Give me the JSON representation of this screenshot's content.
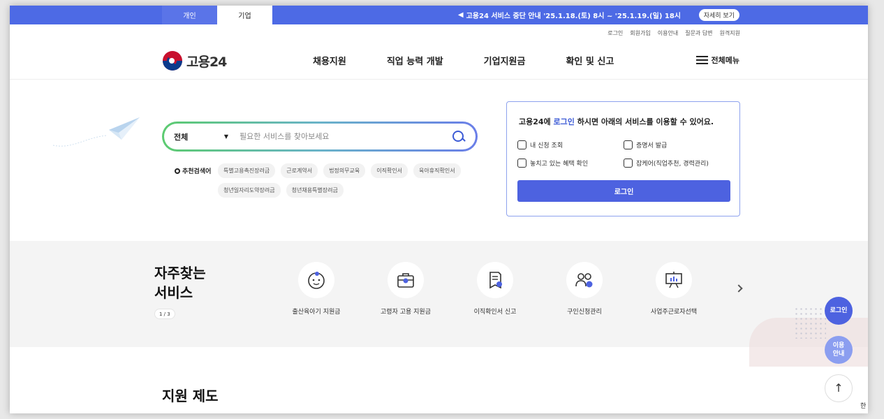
{
  "topbar": {
    "tab_personal": "개인",
    "tab_company": "기업",
    "notice": "고용24 서비스 중단 안내 '25.1.18.(토) 8시 ~ '25.1.19.(일) 18시",
    "notice_button": "자세히 보기",
    "megaphone_icon": "megaphone-icon"
  },
  "util_links": [
    "로그인",
    "회원가입",
    "이용안내",
    "질문과 답변",
    "원격지원"
  ],
  "header": {
    "logo_text": "고용24",
    "menu": [
      "채용지원",
      "직업 능력 개발",
      "기업지원금",
      "확인 및 신고"
    ],
    "all_menu": "전체메뉴"
  },
  "search": {
    "category": "전체",
    "placeholder": "필요한 서비스를 찾아보세요"
  },
  "recommended": {
    "label": "추천검색어",
    "chips": [
      "특별고용촉진장려금",
      "근로계약서",
      "법정의무교육",
      "이직확인서",
      "육아휴직확인서",
      "청년일자리도약장려금",
      "청년채용특별장려금"
    ]
  },
  "login_box": {
    "msg_pre": "고용24에 ",
    "msg_link": "로그인",
    "msg_post": " 하시면 아래의 서비스를 이용할 수 있어요.",
    "services": [
      "내 신청 조회",
      "증명서 발급",
      "놓치고 있는 혜택 확인",
      "잡케어(직업추천, 경력관리)"
    ],
    "button": "로그인"
  },
  "frequent": {
    "title_line1": "자주찾는",
    "title_line2": "서비스",
    "pager": "1 / 3",
    "items": [
      {
        "label": "출산육아기 지원금",
        "icon": "baby-icon"
      },
      {
        "label": "고령자 고용 지원금",
        "icon": "briefcase-icon"
      },
      {
        "label": "이직확인서 신고",
        "icon": "document-check-icon"
      },
      {
        "label": "구인신청관리",
        "icon": "users-check-icon"
      },
      {
        "label": "사업주근로자선택",
        "icon": "presentation-board-icon"
      }
    ]
  },
  "support": {
    "title": "지원 제도"
  },
  "floating": {
    "login": "로그인",
    "guide_line1": "이용",
    "guide_line2": "안내",
    "top": "↑"
  },
  "corner_glyph": "한",
  "colors": {
    "primary": "#4d62e0",
    "topbar": "#4d6ae5",
    "accent_text": "#3c5bd6"
  }
}
